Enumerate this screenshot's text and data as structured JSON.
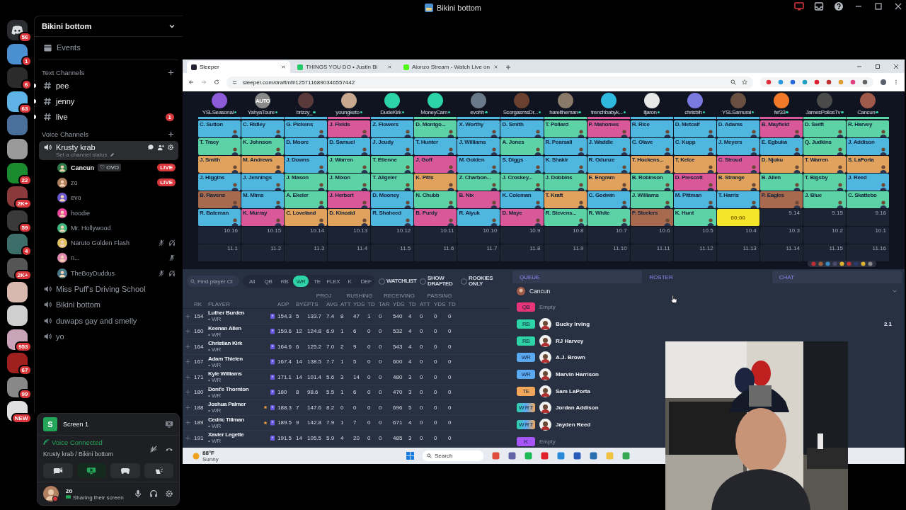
{
  "window": {
    "title": "Bikini bottom"
  },
  "servers": [
    {
      "badge": "56",
      "kind": "home"
    },
    {
      "color": "#4a8fd0",
      "badge": "1"
    },
    {
      "color": "#2b2b2b",
      "badge": "6"
    },
    {
      "color": "#5fb3e6",
      "badge": "63"
    },
    {
      "color": "#4a6f9a"
    },
    {
      "color": "#9a9a9a"
    },
    {
      "color": "#1c8a2e",
      "badge": "22"
    },
    {
      "color": "#8a3a3a",
      "badge": "2K+"
    },
    {
      "color": "#3a3a3a",
      "badge": "59"
    },
    {
      "color": "#3d6f6a",
      "badge": "4"
    },
    {
      "color": "#555555",
      "badge": "2K+"
    },
    {
      "color": "#d9b8b0"
    },
    {
      "color": "#cfcfcf"
    },
    {
      "color": "#c9a3b8",
      "badge": "953"
    },
    {
      "color": "#a02020",
      "badge": "67"
    },
    {
      "color": "#888888",
      "badge": "99"
    },
    {
      "color": "#e0e0e0",
      "badge": "NEW"
    }
  ],
  "sidebar": {
    "server_name": "Bikini bottom",
    "events": "Events",
    "text_heading": "Text Channels",
    "text_channels": [
      {
        "name": "pee",
        "unread": true
      },
      {
        "name": "jenny",
        "unread": true
      },
      {
        "name": "live",
        "unread": true,
        "badge": "1"
      }
    ],
    "voice_heading": "Voice Channels",
    "active_voice": {
      "name": "Krusty krab",
      "status": "Set a channel status",
      "selected": true
    },
    "members": [
      {
        "name": "Cancun",
        "tag": "♡ OVO",
        "live": "LIVE",
        "color": "#2f7a4a",
        "muted": false,
        "deafened": false,
        "speaking": true
      },
      {
        "name": "zo",
        "live": "LIVE",
        "color": "#b08060",
        "muted": false,
        "deafened": false,
        "speaking": false
      },
      {
        "name": "evo",
        "color": "#6a5acd",
        "muted": false,
        "deafened": false,
        "speaking": false
      },
      {
        "name": "hoodie",
        "color": "#eb459e",
        "muted": false,
        "deafened": false,
        "speaking": false
      },
      {
        "name": "Mr. Hollywood",
        "color": "#43b581",
        "muted": false,
        "deafened": false,
        "speaking": false
      },
      {
        "name": "Naruto Golden Flash",
        "color": "#e0c060",
        "muted": true,
        "deafened": true,
        "speaking": false
      },
      {
        "name": "n...",
        "color": "#e08ab0",
        "muted": true,
        "deafened": false,
        "speaking": false
      },
      {
        "name": "TheBoyDuddus",
        "color": "#4a7a8a",
        "muted": true,
        "deafened": true,
        "speaking": false
      }
    ],
    "voice_channels": [
      {
        "name": "Miss Puff's Driving School"
      },
      {
        "name": "Bikini bottom"
      },
      {
        "name": "duwaps gay and smelly"
      },
      {
        "name": "yo"
      }
    ]
  },
  "panel": {
    "stream_icon": "S",
    "stream_title": "Screen 1",
    "voice_state": "Voice Connected",
    "voice_location": "Krusty krab / Bikini bottom",
    "user": "zo",
    "user_status": "Sharing their screen"
  },
  "browser": {
    "tabs": [
      {
        "title": "Sleeper",
        "selected": true
      },
      {
        "title": "THINGS YOU DO • Justin Bi",
        "selected": false
      },
      {
        "title": "Alonzo Stream - Watch Live on",
        "selected": false
      }
    ],
    "url": "sleeper.com/draft/nfl/1257116890346557442"
  },
  "board": {
    "managers": [
      {
        "name": "YSLSeasonal",
        "color": "#8e5bd8"
      },
      {
        "name": "YahyaToure",
        "color": "#8a8a8a",
        "label": "AUTO"
      },
      {
        "name": "brizzy_",
        "color": "#5a3a3a"
      },
      {
        "name": "youngketo",
        "color": "#c9a890"
      },
      {
        "name": "DudeKirk",
        "color": "#2dd4a8"
      },
      {
        "name": "MoneyCam",
        "color": "#2dd4a8"
      },
      {
        "name": "evohh",
        "color": "#6a7a8a"
      },
      {
        "name": "ScorgasmsDr...",
        "color": "#6a4030"
      },
      {
        "name": "hareltheman",
        "color": "#8a7a6a"
      },
      {
        "name": "trenchbabyk...",
        "color": "#2fb8e0"
      },
      {
        "name": "lljaron",
        "color": "#e8e8e8"
      },
      {
        "name": "chrisbih",
        "color": "#7a7ae0"
      },
      {
        "name": "YSLSamurai",
        "color": "#6a5040"
      },
      {
        "name": "fef33",
        "color": "#f07a2a"
      },
      {
        "name": "JamesPollosTv",
        "color": "#4a4a4a"
      },
      {
        "name": "Cancun",
        "color": "#a05a4a"
      }
    ],
    "rows": [
      [
        {
          "kind": "player",
          "name": "C. Sutton",
          "color": "#4fb6e0"
        },
        {
          "kind": "player",
          "name": "C. Ridley",
          "color": "#4fb6e0"
        },
        {
          "kind": "player",
          "name": "G. Pickens",
          "color": "#4fb6e0"
        },
        {
          "kind": "player",
          "name": "J. Fields",
          "color": "#d9589a"
        },
        {
          "kind": "player",
          "name": "Z. Flowers",
          "color": "#4fb6e0"
        },
        {
          "kind": "player",
          "name": "D. Montgo...",
          "color": "#5cd3a6"
        },
        {
          "kind": "player",
          "name": "X. Worthy",
          "color": "#4fb6e0"
        },
        {
          "kind": "player",
          "name": "D. Smith",
          "color": "#4fb6e0"
        },
        {
          "kind": "player",
          "name": "T. Pollard",
          "color": "#5cd3a6"
        },
        {
          "kind": "player",
          "name": "P. Mahomes",
          "color": "#d9589a"
        },
        {
          "kind": "player",
          "name": "R. Rice",
          "color": "#4fb6e0"
        },
        {
          "kind": "player",
          "name": "D. Metcalf",
          "color": "#4fb6e0"
        },
        {
          "kind": "player",
          "name": "D. Adams",
          "color": "#4fb6e0"
        },
        {
          "kind": "player",
          "name": "B. Mayfield",
          "color": "#d9589a"
        },
        {
          "kind": "player",
          "name": "D. Swift",
          "color": "#5cd3a6"
        },
        {
          "kind": "player",
          "name": "R. Harvey",
          "color": "#5cd3a6"
        }
      ],
      [
        {
          "kind": "player",
          "name": "T. Tracy",
          "color": "#5cd3a6"
        },
        {
          "kind": "player",
          "name": "K. Johnson",
          "color": "#5cd3a6"
        },
        {
          "kind": "player",
          "name": "D. Moore",
          "color": "#4fb6e0"
        },
        {
          "kind": "player",
          "name": "D. Samuel",
          "color": "#4fb6e0"
        },
        {
          "kind": "player",
          "name": "J. Jeudy",
          "color": "#4fb6e0"
        },
        {
          "kind": "player",
          "name": "T. Hunter",
          "color": "#4fb6e0"
        },
        {
          "kind": "player",
          "name": "J. Williams",
          "color": "#4fb6e0"
        },
        {
          "kind": "player",
          "name": "A. Jones",
          "color": "#5cd3a6"
        },
        {
          "kind": "player",
          "name": "R. Pearsall",
          "color": "#4fb6e0"
        },
        {
          "kind": "player",
          "name": "J. Waddle",
          "color": "#4fb6e0"
        },
        {
          "kind": "player",
          "name": "C. Olave",
          "color": "#4fb6e0"
        },
        {
          "kind": "player",
          "name": "C. Kupp",
          "color": "#4fb6e0"
        },
        {
          "kind": "player",
          "name": "J. Meyers",
          "color": "#4fb6e0"
        },
        {
          "kind": "player",
          "name": "E. Egbuka",
          "color": "#4fb6e0"
        },
        {
          "kind": "player",
          "name": "Q. Judkins",
          "color": "#5cd3a6"
        },
        {
          "kind": "player",
          "name": "J. Addison",
          "color": "#4fb6e0"
        }
      ],
      [
        {
          "kind": "player",
          "name": "J. Smith",
          "color": "#e0a25c"
        },
        {
          "kind": "player",
          "name": "M. Andrews",
          "color": "#e0a25c"
        },
        {
          "kind": "player",
          "name": "J. Downs",
          "color": "#4fb6e0"
        },
        {
          "kind": "player",
          "name": "J. Warren",
          "color": "#5cd3a6"
        },
        {
          "kind": "player",
          "name": "T. Etienne",
          "color": "#5cd3a6"
        },
        {
          "kind": "player",
          "name": "J. Goff",
          "color": "#d9589a"
        },
        {
          "kind": "player",
          "name": "M. Golden",
          "color": "#4fb6e0"
        },
        {
          "kind": "player",
          "name": "S. Diggs",
          "color": "#4fb6e0"
        },
        {
          "kind": "player",
          "name": "K. Shakir",
          "color": "#4fb6e0"
        },
        {
          "kind": "player",
          "name": "R. Odunze",
          "color": "#4fb6e0"
        },
        {
          "kind": "player",
          "name": "T. Hockens...",
          "color": "#e0a25c"
        },
        {
          "kind": "player",
          "name": "T. Kelce",
          "color": "#e0a25c"
        },
        {
          "kind": "player",
          "name": "C. Stroud",
          "color": "#d9589a"
        },
        {
          "kind": "player",
          "name": "D. Njoku",
          "color": "#e0a25c"
        },
        {
          "kind": "player",
          "name": "T. Warren",
          "color": "#e0a25c"
        },
        {
          "kind": "player",
          "name": "S. LaPorta",
          "color": "#e0a25c"
        }
      ],
      [
        {
          "kind": "player",
          "name": "J. Higgins",
          "color": "#4fb6e0"
        },
        {
          "kind": "player",
          "name": "J. Jennings",
          "color": "#4fb6e0"
        },
        {
          "kind": "player",
          "name": "J. Mason",
          "color": "#5cd3a6"
        },
        {
          "kind": "player",
          "name": "J. Mixon",
          "color": "#5cd3a6"
        },
        {
          "kind": "player",
          "name": "T. Allgeier",
          "color": "#5cd3a6"
        },
        {
          "kind": "player",
          "name": "K. Pitts",
          "color": "#e0a25c"
        },
        {
          "kind": "player",
          "name": "Z. Charbon...",
          "color": "#5cd3a6"
        },
        {
          "kind": "player",
          "name": "J. Croskey...",
          "color": "#5cd3a6"
        },
        {
          "kind": "player",
          "name": "J. Dobbins",
          "color": "#5cd3a6"
        },
        {
          "kind": "player",
          "name": "E. Engram",
          "color": "#e0a25c"
        },
        {
          "kind": "player",
          "name": "B. Robinson",
          "color": "#5cd3a6"
        },
        {
          "kind": "player",
          "name": "D. Prescott",
          "color": "#d9589a"
        },
        {
          "kind": "player",
          "name": "B. Strange",
          "color": "#e0a25c"
        },
        {
          "kind": "player",
          "name": "B. Allen",
          "color": "#5cd3a6"
        },
        {
          "kind": "player",
          "name": "T. Bigsby",
          "color": "#5cd3a6"
        },
        {
          "kind": "player",
          "name": "J. Reed",
          "color": "#4fb6e0"
        }
      ],
      [
        {
          "kind": "player",
          "name": "B. Ravens",
          "color": "#a86a4e"
        },
        {
          "kind": "player",
          "name": "M. Mims",
          "color": "#4fb6e0"
        },
        {
          "kind": "player",
          "name": "A. Ekeler",
          "color": "#5cd3a6"
        },
        {
          "kind": "player",
          "name": "J. Herbert",
          "color": "#d9589a"
        },
        {
          "kind": "player",
          "name": "D. Mooney",
          "color": "#4fb6e0"
        },
        {
          "kind": "player",
          "name": "N. Chubb",
          "color": "#5cd3a6"
        },
        {
          "kind": "player",
          "name": "B. Nix",
          "color": "#d9589a"
        },
        {
          "kind": "player",
          "name": "K. Coleman",
          "color": "#4fb6e0"
        },
        {
          "kind": "player",
          "name": "T. Kraft",
          "color": "#e0a25c"
        },
        {
          "kind": "player",
          "name": "C. Godwin",
          "color": "#4fb6e0"
        },
        {
          "kind": "player",
          "name": "J. Williams",
          "color": "#5cd3a6"
        },
        {
          "kind": "player",
          "name": "M. Pittman",
          "color": "#4fb6e0"
        },
        {
          "kind": "player",
          "name": "T. Harris",
          "color": "#4fb6e0"
        },
        {
          "kind": "player",
          "name": "P. Eagles",
          "color": "#a86a4e"
        },
        {
          "kind": "player",
          "name": "J. Blue",
          "color": "#5cd3a6"
        },
        {
          "kind": "player",
          "name": "C. Skattebo",
          "color": "#5cd3a6"
        }
      ],
      [
        {
          "kind": "player",
          "name": "R. Bateman",
          "color": "#4fb6e0"
        },
        {
          "kind": "player",
          "name": "K. Murray",
          "color": "#d9589a"
        },
        {
          "kind": "player",
          "name": "C. Loveland",
          "color": "#e0a25c"
        },
        {
          "kind": "player",
          "name": "D. Kincaid",
          "color": "#e0a25c"
        },
        {
          "kind": "player",
          "name": "R. Shaheed",
          "color": "#4fb6e0"
        },
        {
          "kind": "player",
          "name": "B. Purdy",
          "color": "#d9589a"
        },
        {
          "kind": "player",
          "name": "R. Aiyuk",
          "color": "#4fb6e0"
        },
        {
          "kind": "player",
          "name": "D. Maye",
          "color": "#d9589a"
        },
        {
          "kind": "player",
          "name": "R. Stevens...",
          "color": "#5cd3a6"
        },
        {
          "kind": "player",
          "name": "R. White",
          "color": "#5cd3a6"
        },
        {
          "kind": "player",
          "name": "P. Steelers",
          "color": "#a86a4e"
        },
        {
          "kind": "player",
          "name": "K. Hunt",
          "color": "#5cd3a6"
        },
        {
          "kind": "timer",
          "time": "00:00"
        },
        {
          "kind": "empty",
          "pick": "9.14"
        },
        {
          "kind": "empty",
          "pick": "9.15"
        },
        {
          "kind": "empty",
          "pick": "9.16"
        }
      ],
      [
        {
          "kind": "empty",
          "pick": "10.16"
        },
        {
          "kind": "empty",
          "pick": "10.15"
        },
        {
          "kind": "empty",
          "pick": "10.14"
        },
        {
          "kind": "empty",
          "pick": "10.13"
        },
        {
          "kind": "empty",
          "pick": "10.12"
        },
        {
          "kind": "empty",
          "pick": "10.11"
        },
        {
          "kind": "empty",
          "pick": "10.10"
        },
        {
          "kind": "empty",
          "pick": "10.9"
        },
        {
          "kind": "empty",
          "pick": "10.8"
        },
        {
          "kind": "empty",
          "pick": "10.7"
        },
        {
          "kind": "empty",
          "pick": "10.6"
        },
        {
          "kind": "empty",
          "pick": "10.5"
        },
        {
          "kind": "empty",
          "pick": "10.4"
        },
        {
          "kind": "empty",
          "pick": "10.3"
        },
        {
          "kind": "empty",
          "pick": "10.2"
        },
        {
          "kind": "empty",
          "pick": "10.1"
        }
      ],
      [
        {
          "kind": "empty",
          "pick": "11.1"
        },
        {
          "kind": "empty",
          "pick": "11.2"
        },
        {
          "kind": "empty",
          "pick": "11.3"
        },
        {
          "kind": "empty",
          "pick": "11.4"
        },
        {
          "kind": "empty",
          "pick": "11.5"
        },
        {
          "kind": "empty",
          "pick": "11.6"
        },
        {
          "kind": "empty",
          "pick": "11.7"
        },
        {
          "kind": "empty",
          "pick": "11.8"
        },
        {
          "kind": "empty",
          "pick": "11.9"
        },
        {
          "kind": "empty",
          "pick": "11.10"
        },
        {
          "kind": "empty",
          "pick": "11.11"
        },
        {
          "kind": "empty",
          "pick": "11.12"
        },
        {
          "kind": "empty",
          "pick": "11.13"
        },
        {
          "kind": "empty",
          "pick": "11.14"
        },
        {
          "kind": "empty",
          "pick": "11.15"
        },
        {
          "kind": "empty",
          "pick": "11.16"
        }
      ]
    ]
  },
  "player_search": {
    "placeholder": "Find player Ct"
  },
  "positions": [
    {
      "label": "All",
      "selected": false
    },
    {
      "label": "QB",
      "selected": false
    },
    {
      "label": "RB",
      "selected": false
    },
    {
      "label": "WR",
      "selected": true
    },
    {
      "label": "TE",
      "selected": false
    },
    {
      "label": "FLEX",
      "selected": false
    },
    {
      "label": "K",
      "selected": false
    },
    {
      "label": "DEF",
      "selected": false
    }
  ],
  "toggles": [
    {
      "label": "WATCHLIST",
      "checked": false
    },
    {
      "label": "SHOW DRAFTED",
      "checked": false
    },
    {
      "label": "ROOKIES ONLY",
      "checked": false
    }
  ],
  "table": {
    "groups": [
      "PROJ",
      "RUSHING",
      "RECEIVING",
      "PASSING"
    ],
    "rank_header": "RK",
    "player_header": "PLAYER",
    "columns": [
      "ADP",
      "BYE",
      "PTS",
      "AVG",
      "ATT",
      "YDS",
      "TD",
      "TAR",
      "YDS",
      "TD",
      "ATT",
      "YDS",
      "TD"
    ],
    "rows": [
      {
        "rank": "154",
        "name": "Luther Burden",
        "pos": "• WR",
        "starred": false,
        "cells": [
          "154.3",
          "5",
          "133.7",
          "7.4",
          "8",
          "47",
          "1",
          "0",
          "540",
          "4",
          "0",
          "0",
          "0"
        ]
      },
      {
        "rank": "160",
        "name": "Keenan Allen",
        "pos": "• WR",
        "starred": false,
        "cells": [
          "159.6",
          "12",
          "124.8",
          "6.9",
          "1",
          "6",
          "0",
          "0",
          "532",
          "4",
          "0",
          "0",
          "0"
        ]
      },
      {
        "rank": "164",
        "name": "Christian Kirk",
        "pos": "• WR",
        "starred": false,
        "cells": [
          "164.6",
          "6",
          "125.2",
          "7.0",
          "2",
          "9",
          "0",
          "0",
          "543",
          "4",
          "0",
          "0",
          "0"
        ]
      },
      {
        "rank": "167",
        "name": "Adam Thielen",
        "pos": "• WR",
        "starred": false,
        "cells": [
          "167.4",
          "14",
          "138.5",
          "7.7",
          "1",
          "5",
          "0",
          "0",
          "600",
          "4",
          "0",
          "0",
          "0"
        ]
      },
      {
        "rank": "171",
        "name": "Kyle Williams",
        "pos": "• WR",
        "starred": false,
        "cells": [
          "171.1",
          "14",
          "101.4",
          "5.6",
          "3",
          "14",
          "0",
          "0",
          "480",
          "3",
          "0",
          "0",
          "0"
        ]
      },
      {
        "rank": "180",
        "name": "Dont'e Thornton",
        "pos": "• WR",
        "starred": false,
        "cells": [
          "180",
          "8",
          "98.6",
          "5.5",
          "1",
          "6",
          "0",
          "0",
          "470",
          "3",
          "0",
          "0",
          "0"
        ]
      },
      {
        "rank": "188",
        "name": "Joshua Palmer",
        "pos": "• WR",
        "starred": true,
        "cells": [
          "188.3",
          "7",
          "147.6",
          "8.2",
          "0",
          "0",
          "0",
          "0",
          "696",
          "5",
          "0",
          "0",
          "0"
        ]
      },
      {
        "rank": "189",
        "name": "Cedric Tillman",
        "pos": "• WR",
        "starred": true,
        "cells": [
          "189.5",
          "9",
          "142.8",
          "7.9",
          "1",
          "7",
          "0",
          "0",
          "671",
          "4",
          "0",
          "0",
          "0"
        ]
      },
      {
        "rank": "191",
        "name": "Xavier Legette",
        "pos": "• WR",
        "starred": false,
        "cells": [
          "191.5",
          "14",
          "105.5",
          "5.9",
          "4",
          "20",
          "0",
          "0",
          "485",
          "3",
          "0",
          "0",
          "0"
        ]
      }
    ]
  },
  "side_tabs": [
    {
      "label": "QUEUE",
      "selected": false
    },
    {
      "label": "ROSTER",
      "selected": true
    },
    {
      "label": "CHAT",
      "selected": false
    }
  ],
  "roster": {
    "owner": "Cancun",
    "slots": [
      {
        "pos": "QB",
        "kind": "single",
        "color": "#e8357a",
        "player": "Empty",
        "filled": false
      },
      {
        "pos": "RB",
        "kind": "single",
        "color": "#2dd4a8",
        "player": "Bucky Irving",
        "filled": true,
        "pick": "2.1"
      },
      {
        "pos": "RB",
        "kind": "single",
        "color": "#2dd4a8",
        "player": "RJ Harvey",
        "filled": true
      },
      {
        "pos": "WR",
        "kind": "single",
        "color": "#5aa8f0",
        "player": "A.J. Brown",
        "filled": true
      },
      {
        "pos": "WR",
        "kind": "single",
        "color": "#5aa8f0",
        "player": "Marvin Harrison",
        "filled": true
      },
      {
        "pos": "TE",
        "kind": "single",
        "color": "#f2a65a",
        "player": "Sam LaPorta",
        "filled": true
      },
      {
        "pos": "W R T",
        "kind": "flex",
        "player": "Jordan Addison",
        "filled": true
      },
      {
        "pos": "W R T",
        "kind": "flex",
        "player": "Jayden Reed",
        "filled": true
      },
      {
        "pos": "K",
        "kind": "single",
        "color": "#a855f7",
        "player": "Empty",
        "filled": false
      }
    ]
  },
  "taskbar": {
    "temperature": "88°F",
    "weather": "Sunny",
    "search_placeholder": "Search"
  }
}
